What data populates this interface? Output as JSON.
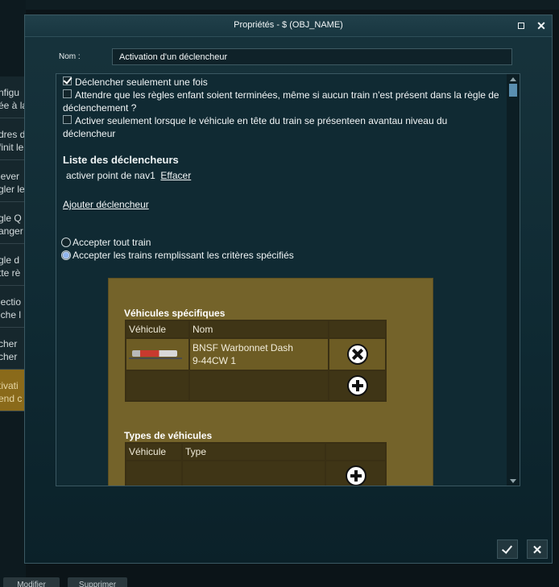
{
  "background": {
    "list_items": [
      [
        "nfigu",
        "ée à la"
      ],
      [
        "dres d",
        "finit le"
      ],
      [
        "lever",
        "gler le"
      ],
      [
        "gle Q",
        "anger"
      ],
      [
        "gle d",
        "tte rè"
      ],
      [
        "lectio",
        "iche l"
      ],
      [
        "cher",
        "cher"
      ],
      [
        "tivati",
        "end c"
      ]
    ],
    "bottom_buttons": [
      "Modifier",
      "Supprimer"
    ]
  },
  "dialog": {
    "title": "Propriétés - $ (OBJ_NAME)",
    "name_label": "Nom :",
    "name_value": "Activation d'un déclencheur",
    "options": {
      "trigger_once": {
        "label": "Déclencher seulement une fois",
        "checked": true
      },
      "wait_children": {
        "label": "Attendre que les règles enfant soient terminées, même si aucun train n'est présent dans la règle de déclenchement ?",
        "checked": false
      },
      "lead_vehicle": {
        "label": "Activer seulement lorsque le véhicule en tête du train se présenteen avantau niveau du déclencheur",
        "checked": false
      }
    },
    "triggers_title": "Liste des déclencheurs",
    "triggers": [
      {
        "name": "activer point de nav1",
        "action": "Effacer"
      }
    ],
    "add_trigger": "Ajouter déclencheur",
    "radio_all": "Accepter tout train",
    "radio_criteria": "Accepter les trains remplissant les critères spécifiés",
    "radio_selected": "criteria",
    "specific_vehicles": {
      "title": "Véhicules spécifiques",
      "headers": [
        "Véhicule",
        "Nom",
        ""
      ],
      "rows": [
        {
          "name_line1": "BNSF Warbonnet Dash",
          "name_line2": "9-44CW 1"
        }
      ]
    },
    "vehicle_types": {
      "title": "Types de véhicules",
      "headers": [
        "Véhicule",
        "Type",
        ""
      ]
    }
  }
}
